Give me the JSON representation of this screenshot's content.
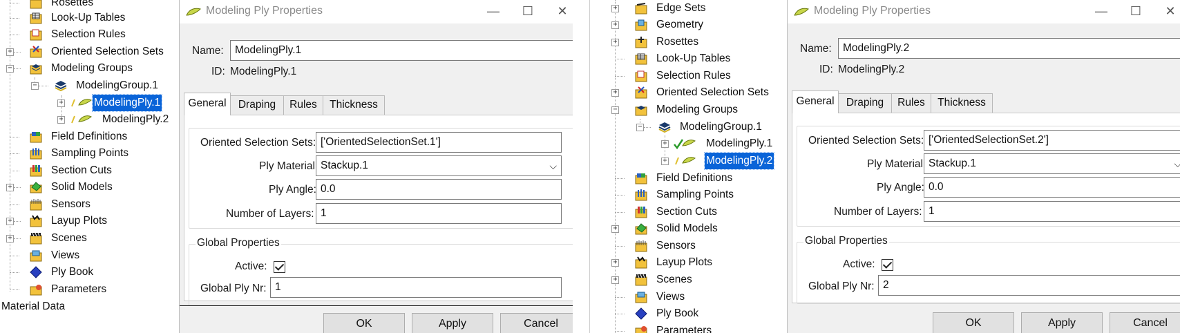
{
  "left": {
    "tree": {
      "items": {
        "rosettes": "Rosettes",
        "lookup_tables": "Look-Up Tables",
        "selection_rules": "Selection Rules",
        "oriented_selection_sets": "Oriented Selection Sets",
        "modeling_groups": "Modeling Groups",
        "modeling_group_1": "ModelingGroup.1",
        "modeling_ply_1": "ModelingPly.1",
        "modeling_ply_2": "ModelingPly.2",
        "field_definitions": "Field Definitions",
        "sampling_points": "Sampling Points",
        "section_cuts": "Section Cuts",
        "solid_models": "Solid Models",
        "sensors": "Sensors",
        "layup_plots": "Layup Plots",
        "scenes": "Scenes",
        "views": "Views",
        "ply_book": "Ply Book",
        "parameters": "Parameters",
        "material_data": "Material Data"
      },
      "selected": "ModelingPly.1"
    },
    "dialog": {
      "title": "Modeling Ply Properties",
      "name_label": "Name:",
      "name_value": "ModelingPly.1",
      "id_label": "ID:",
      "id_value": "ModelingPly.1",
      "tabs": [
        "General",
        "Draping",
        "Rules",
        "Thickness"
      ],
      "active_tab": "General",
      "oss_label": "Oriented Selection Sets:",
      "oss_value": "['OrientedSelectionSet.1']",
      "material_label": "Ply Material:",
      "material_value": "Stackup.1",
      "angle_label": "Ply Angle:",
      "angle_value": "0.0",
      "layers_label": "Number of Layers:",
      "layers_value": "1",
      "global_group": "Global Properties",
      "active_label": "Active:",
      "active_checked": true,
      "global_nr_label": "Global Ply Nr:",
      "global_nr_value": "1",
      "ok": "OK",
      "apply": "Apply",
      "cancel": "Cancel"
    }
  },
  "right": {
    "tree": {
      "items": {
        "edge_sets": "Edge Sets",
        "geometry": "Geometry",
        "rosettes": "Rosettes",
        "lookup_tables": "Look-Up Tables",
        "selection_rules": "Selection Rules",
        "oriented_selection_sets": "Oriented Selection Sets",
        "modeling_groups": "Modeling Groups",
        "modeling_group_1": "ModelingGroup.1",
        "modeling_ply_1": "ModelingPly.1",
        "modeling_ply_2": "ModelingPly.2",
        "field_definitions": "Field Definitions",
        "sampling_points": "Sampling Points",
        "section_cuts": "Section Cuts",
        "solid_models": "Solid Models",
        "sensors": "Sensors",
        "layup_plots": "Layup Plots",
        "scenes": "Scenes",
        "views": "Views",
        "ply_book": "Ply Book",
        "parameters": "Parameters"
      },
      "selected": "ModelingPly.2"
    },
    "dialog": {
      "title": "Modeling Ply Properties",
      "name_label": "Name:",
      "name_value": "ModelingPly.2",
      "id_label": "ID:",
      "id_value": "ModelingPly.2",
      "tabs": [
        "General",
        "Draping",
        "Rules",
        "Thickness"
      ],
      "active_tab": "General",
      "oss_label": "Oriented Selection Sets:",
      "oss_value": "['OrientedSelectionSet.2']",
      "material_label": "Ply Material:",
      "material_value": "Stackup.1",
      "angle_label": "Ply Angle:",
      "angle_value": "0.0",
      "layers_label": "Number of Layers:",
      "layers_value": "1",
      "global_group": "Global Properties",
      "active_label": "Active:",
      "active_checked": true,
      "global_nr_label": "Global Ply Nr:",
      "global_nr_value": "2",
      "ok": "OK",
      "apply": "Apply",
      "cancel": "Cancel"
    }
  },
  "icons": {
    "rosettes": "rosettes-icon",
    "lookup_tables": "lookup-table-icon",
    "selection_rules": "selection-rules-icon",
    "oriented_selection_sets": "oriented-selection-set-icon",
    "modeling_groups": "modeling-groups-icon",
    "modeling_ply": "modeling-ply-icon",
    "field_definitions": "field-definitions-icon",
    "sampling_points": "sampling-points-icon",
    "section_cuts": "section-cuts-icon",
    "solid_models": "solid-models-icon",
    "sensors": "sensors-icon",
    "layup_plots": "layup-plots-icon",
    "scenes": "scenes-icon",
    "views": "views-icon",
    "ply_book": "ply-book-icon",
    "parameters": "parameters-icon",
    "edge_sets": "edge-sets-icon",
    "geometry": "geometry-icon"
  },
  "colors": {
    "selection": "#0a64d8",
    "folder": "#f2c23c",
    "ply": "#c8d64a"
  }
}
